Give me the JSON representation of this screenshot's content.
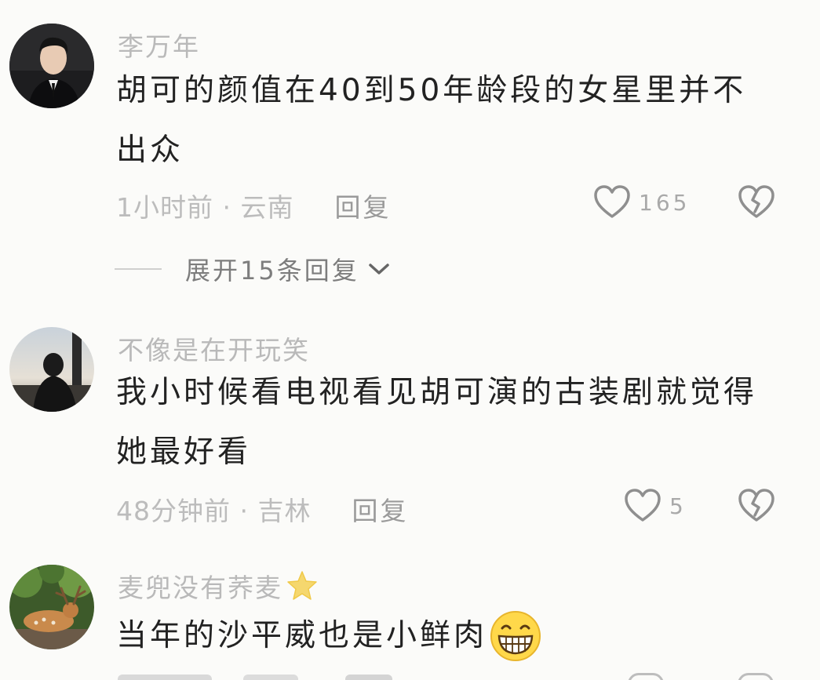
{
  "comments": [
    {
      "username": "李万年",
      "text": "胡可的颜值在40到50年龄段的女星里并不出众",
      "time_location": "1小时前 · 云南",
      "reply_label": "回复",
      "like_count": "165",
      "expand_label": "展开15条回复"
    },
    {
      "username": "不像是在开玩笑",
      "text": "我小时候看电视看见胡可演的古装剧就觉得她最好看",
      "time_location": "48分钟前 · 吉林",
      "reply_label": "回复",
      "like_count": "5"
    },
    {
      "username": "麦兜没有荞麦",
      "username_emoji": "star-emoji",
      "text": "当年的沙平威也是小鲜肉",
      "text_emoji": "grinning-face-emoji"
    }
  ],
  "colors": {
    "background": "#fbfbf9",
    "username": "#b9b9b9",
    "text": "#222222",
    "meta": "#bcbcbc",
    "icon": "#9a9a9a"
  }
}
